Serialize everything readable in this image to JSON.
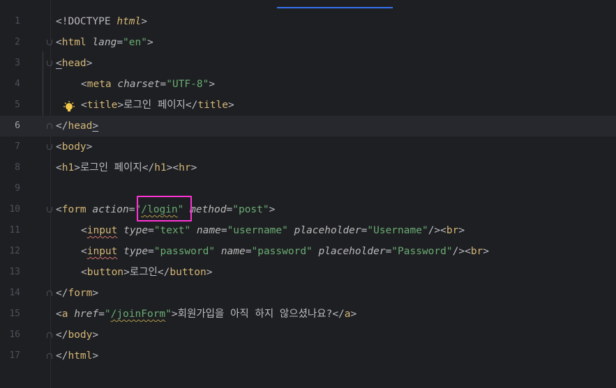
{
  "editor": {
    "language": "html",
    "current_line": 6,
    "lines": [
      {
        "n": "1",
        "parts": [
          "<!DOCTYPE ",
          "html",
          ">"
        ]
      },
      {
        "n": "2",
        "parts": [
          "<",
          "html",
          " ",
          "lang",
          "=",
          "\"en\"",
          ">"
        ]
      },
      {
        "n": "3",
        "parts": [
          "<",
          "head",
          ">"
        ]
      },
      {
        "n": "4",
        "parts": [
          "<",
          "meta",
          " ",
          "charset",
          "=",
          "\"UTF-8\"",
          ">"
        ]
      },
      {
        "n": "5",
        "parts": [
          "<",
          "title",
          ">",
          "로그인 페이지",
          "</",
          "title",
          ">"
        ]
      },
      {
        "n": "6",
        "parts": [
          "</",
          "head",
          ">"
        ]
      },
      {
        "n": "7",
        "parts": [
          "<",
          "body",
          ">"
        ]
      },
      {
        "n": "8",
        "parts": [
          "<",
          "h1",
          ">",
          "로그인 페이지",
          "</",
          "h1",
          "><",
          "hr",
          ">"
        ]
      },
      {
        "n": "9",
        "parts": []
      },
      {
        "n": "10",
        "parts": [
          "<",
          "form",
          " ",
          "action",
          "=",
          "\"",
          "/login",
          "\"",
          " ",
          "method",
          "=",
          "\"post\"",
          ">"
        ]
      },
      {
        "n": "11",
        "parts": [
          "<",
          "input",
          " ",
          "type",
          "=",
          "\"text\"",
          " ",
          "name",
          "=",
          "\"username\"",
          " ",
          "placeholder",
          "=",
          "\"Username\"",
          "/><",
          "br",
          ">"
        ]
      },
      {
        "n": "12",
        "parts": [
          "<",
          "input",
          " ",
          "type",
          "=",
          "\"password\"",
          " ",
          "name",
          "=",
          "\"password\"",
          " ",
          "placeholder",
          "=",
          "\"Password\"",
          "/><",
          "br",
          ">"
        ]
      },
      {
        "n": "13",
        "parts": [
          "<",
          "button",
          ">",
          "로그인",
          "</",
          "button",
          ">"
        ]
      },
      {
        "n": "14",
        "parts": [
          "</",
          "form",
          ">"
        ]
      },
      {
        "n": "15",
        "parts": [
          "<",
          "a",
          " ",
          "href",
          "=",
          "\"",
          "/joinForm",
          "\"",
          ">",
          "회원가입을 아직 하지 않으셨나요?",
          "</",
          "a",
          ">"
        ]
      },
      {
        "n": "16",
        "parts": [
          "</",
          "body",
          ">"
        ]
      },
      {
        "n": "17",
        "parts": [
          "</",
          "html",
          ">"
        ]
      }
    ]
  },
  "icons": {
    "intention_bulb": "lightbulb-icon"
  },
  "colors": {
    "background": "#1e1f22",
    "current_line": "#26282e",
    "tag_name": "#d5b778",
    "attribute": "#bababa",
    "string": "#6aab73",
    "text": "#bcbec4",
    "highlight_box": "#ff33d6",
    "squiggle_error": "#d5756c"
  }
}
